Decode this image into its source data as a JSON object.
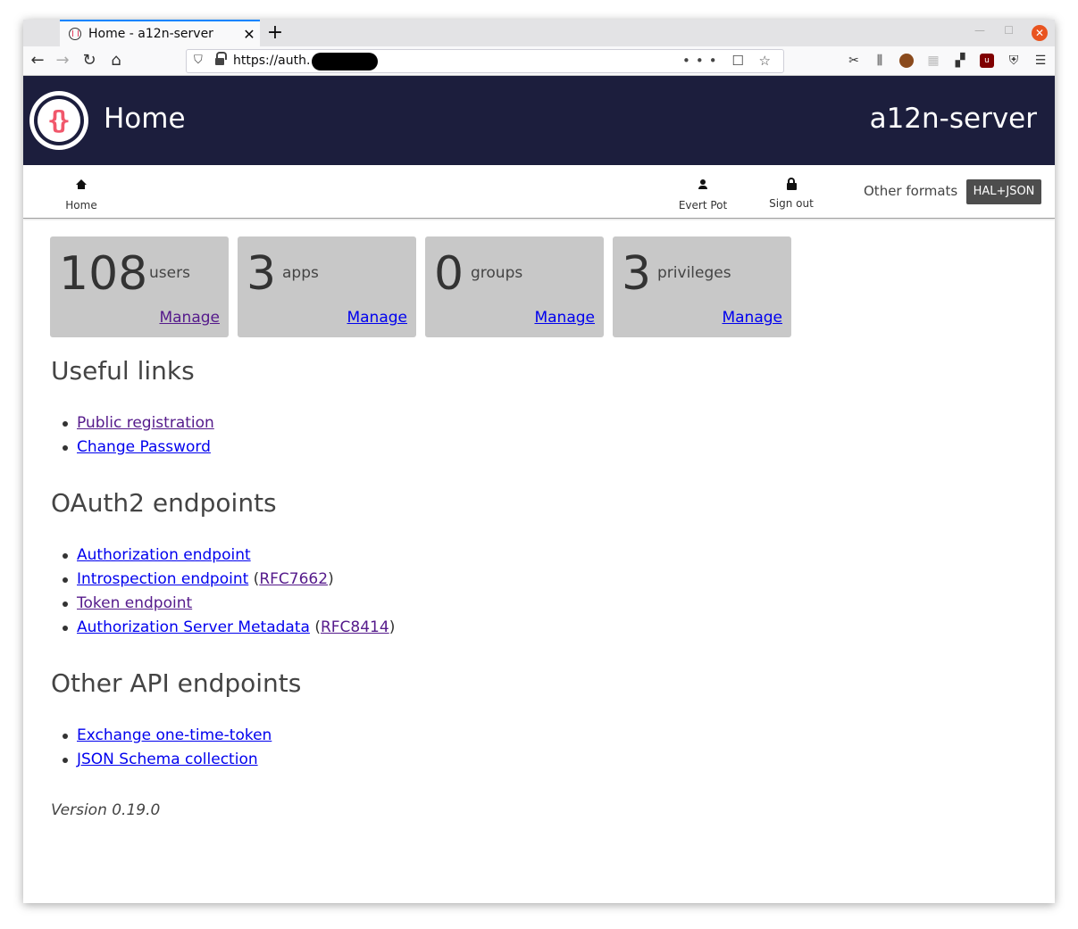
{
  "browser": {
    "tab_title": "Home - a12n-server",
    "tab_close": "✕",
    "new_tab": "+",
    "url": "https://auth.",
    "url_actions": "••• ☐ ☆"
  },
  "header": {
    "title": "Home",
    "brand": "a12n-server"
  },
  "nav": {
    "home": "Home",
    "user": "Evert Pot",
    "signout": "Sign out",
    "other_formats": "Other formats",
    "format_button": "HAL+JSON"
  },
  "stats": [
    {
      "count": "108",
      "label": "users",
      "action": "Manage"
    },
    {
      "count": "3",
      "label": "apps",
      "action": "Manage"
    },
    {
      "count": "0",
      "label": "groups",
      "action": "Manage"
    },
    {
      "count": "3",
      "label": "privileges",
      "action": "Manage"
    }
  ],
  "useful_links": {
    "title": "Useful links",
    "items": [
      "Public registration",
      "Change Password"
    ]
  },
  "oauth2": {
    "title": "OAuth2 endpoints",
    "items": [
      {
        "label": "Authorization endpoint"
      },
      {
        "label": "Introspection endpoint",
        "rfc": "RFC7662"
      },
      {
        "label": "Token endpoint"
      },
      {
        "label": "Authorization Server Metadata",
        "rfc": "RFC8414"
      }
    ]
  },
  "other_api": {
    "title": "Other API endpoints",
    "items": [
      "Exchange one-time-token",
      "JSON Schema collection"
    ]
  },
  "version": "Version 0.19.0",
  "colors": {
    "header_bg": "#1c1e3d",
    "card_bg": "#c8c8c8",
    "link": "#0000ee",
    "visited_link": "#551a8b",
    "format_button_bg": "#4d4d4d",
    "logo_accent": "#f1576b"
  }
}
